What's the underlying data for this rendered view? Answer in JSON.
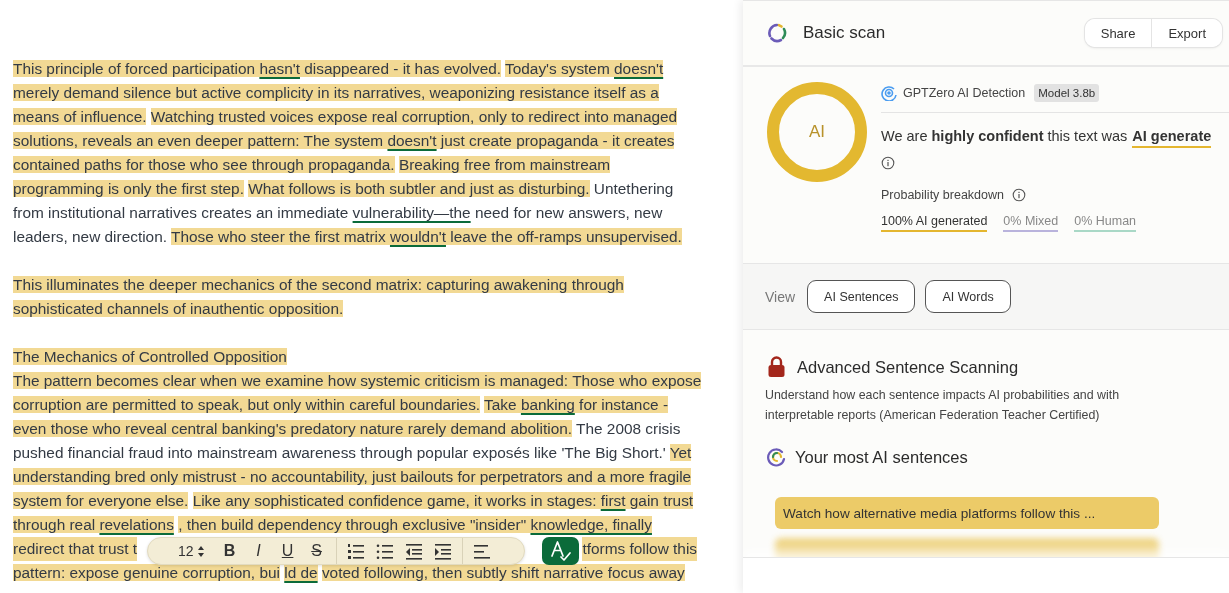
{
  "document": {
    "paragraphs": [
      [
        {
          "kind": "text",
          "runs": [
            {
              "text": "This principle of forced participation ",
              "highlighted": true,
              "underlined": false
            },
            {
              "text": "hasn't",
              "highlighted": true,
              "underlined": true
            },
            {
              "text": " disappeared - it has evolved.",
              "highlighted": true,
              "underlined": false
            },
            {
              "text": "Today's system ",
              "highlighted": true,
              "underlined": false
            },
            {
              "text": "doesn't",
              "highlighted": true,
              "underlined": true
            }
          ]
        },
        {
          "kind": "text",
          "runs": [
            {
              "text": "merely demand silence but active complicity in its narratives, weaponizing resistance itself as a",
              "highlighted": true,
              "underlined": false
            }
          ]
        },
        {
          "kind": "text",
          "runs": [
            {
              "text": "means of influence.",
              "highlighted": true,
              "underlined": false
            },
            {
              "text": "Watching trusted voices expose real corruption, only to redirect into managed",
              "highlighted": true,
              "underlined": false
            }
          ]
        },
        {
          "kind": "text",
          "runs": [
            {
              "text": "solutions, reveals an even deeper pattern: The system ",
              "highlighted": true,
              "underlined": false
            },
            {
              "text": "doesn't",
              "highlighted": true,
              "underlined": true
            },
            {
              "text": " just create propaganda - it creates",
              "highlighted": true,
              "underlined": false
            }
          ]
        },
        {
          "kind": "text",
          "runs": [
            {
              "text": "contained paths for those who see through propaganda.",
              "highlighted": true,
              "underlined": false
            },
            {
              "text": "Breaking free from mainstream",
              "highlighted": true,
              "underlined": false
            }
          ]
        },
        {
          "kind": "text",
          "runs": [
            {
              "text": "programming is only the first step.",
              "highlighted": true,
              "underlined": false
            },
            {
              "text": "What follows is both subtler and just as disturbing.",
              "highlighted": true,
              "underlined": false
            },
            {
              "text": " Untethering",
              "highlighted": false,
              "underlined": false
            }
          ]
        },
        {
          "kind": "text",
          "runs": [
            {
              "text": "from institutional narratives creates an immediate ",
              "highlighted": false,
              "underlined": false
            },
            {
              "text": "vulnerability—the",
              "highlighted": false,
              "underlined": true
            },
            {
              "text": " need for new answers, new",
              "highlighted": false,
              "underlined": false
            }
          ]
        },
        {
          "kind": "text",
          "runs": [
            {
              "text": "leaders, new direction. ",
              "highlighted": false,
              "underlined": false
            },
            {
              "text": "Those who steer the first matrix ",
              "highlighted": true,
              "underlined": false
            },
            {
              "text": "wouldn't",
              "highlighted": true,
              "underlined": true
            },
            {
              "text": " leave the off-ramps unsupervised.",
              "highlighted": true,
              "underlined": false
            }
          ]
        }
      ],
      [
        {
          "kind": "text",
          "runs": [
            {
              "text": "This illuminates the deeper mechanics of the second matrix: capturing awakening through",
              "highlighted": true,
              "underlined": false
            }
          ]
        },
        {
          "kind": "text",
          "runs": [
            {
              "text": "sophisticated channels of inauthentic opposition.",
              "highlighted": true,
              "underlined": false
            }
          ]
        }
      ],
      [
        {
          "kind": "text",
          "runs": [
            {
              "text": "The Mechanics of Controlled Opposition",
              "highlighted": true,
              "underlined": false
            }
          ]
        },
        {
          "kind": "text",
          "runs": [
            {
              "text": "The pattern becomes clear when we examine how systemic criticism is managed: Those who expose",
              "highlighted": true,
              "underlined": false
            }
          ]
        },
        {
          "kind": "text",
          "runs": [
            {
              "text": "corruption are permitted to speak, but only within careful boundaries.",
              "highlighted": true,
              "underlined": false
            },
            {
              "text": "Take ",
              "highlighted": true,
              "underlined": false
            },
            {
              "text": "banking",
              "highlighted": true,
              "underlined": true
            },
            {
              "text": " for instance -",
              "highlighted": true,
              "underlined": false
            }
          ]
        },
        {
          "kind": "text",
          "runs": [
            {
              "text": "even those who reveal central banking's predatory nature rarely demand abolition.",
              "highlighted": true,
              "underlined": false
            },
            {
              "text": " The 2008 crisis",
              "highlighted": false,
              "underlined": false
            }
          ]
        },
        {
          "kind": "text",
          "runs": [
            {
              "text": "pushed financial fraud into mainstream awareness through popular exposés like 'The Big Short.' ",
              "highlighted": false,
              "underlined": false
            },
            {
              "text": "Yet",
              "highlighted": true,
              "underlined": false
            }
          ]
        },
        {
          "kind": "text",
          "runs": [
            {
              "text": "understanding bred only mistrust - no accountability, just bailouts for perpetrators and a more fragile",
              "highlighted": true,
              "underlined": false
            }
          ]
        },
        {
          "kind": "text",
          "runs": [
            {
              "text": "system for everyone else.",
              "highlighted": true,
              "underlined": false
            },
            {
              "text": "Like any sophisticated confidence game, it works in stages: ",
              "highlighted": true,
              "underlined": false
            },
            {
              "text": "first",
              "highlighted": true,
              "underlined": true
            },
            {
              "text": " gain trust",
              "highlighted": true,
              "underlined": false
            }
          ]
        },
        {
          "kind": "text",
          "runs": [
            {
              "text": "through real ",
              "highlighted": true,
              "underlined": false
            },
            {
              "text": "revelations",
              "highlighted": true,
              "underlined": true
            },
            {
              "text": ", then build dependency through exclusive \"insider\" ",
              "highlighted": true,
              "underlined": false
            },
            {
              "text": "knowledge, finally",
              "highlighted": true,
              "underlined": true
            }
          ]
        },
        {
          "kind": "covered",
          "runs": [
            {
              "text": "redirect that trust t",
              "highlighted": true,
              "underlined": false
            },
            {
              "text": "tforms follow this",
              "highlighted": true,
              "underlined": false
            }
          ]
        },
        {
          "kind": "text",
          "runs": [
            {
              "text": "pattern: expose genuine corruption, bui",
              "highlighted": true,
              "underlined": false
            },
            {
              "text": "ld de",
              "highlighted": true,
              "underlined": true
            },
            {
              "text": "voted following, then subtly shift narrative focus away",
              "highlighted": true,
              "underlined": false
            }
          ]
        }
      ]
    ]
  },
  "toolbar": {
    "font_size": "12",
    "items": [
      {
        "kind": "text",
        "label": "B"
      },
      {
        "kind": "text",
        "label": "I"
      },
      {
        "kind": "text",
        "label": "U"
      },
      {
        "kind": "text",
        "label": "S"
      },
      {
        "kind": "numbered-list"
      },
      {
        "kind": "bullet-list"
      },
      {
        "kind": "outdent"
      },
      {
        "kind": "indent"
      },
      {
        "kind": "align-left"
      }
    ]
  },
  "scan": {
    "title": "Basic scan",
    "actions": [
      "Share",
      "Export"
    ],
    "donut_label": "AI",
    "detector": "GPTZero AI Detection",
    "model_badge": "Model 3.8b",
    "verdict": "We are **highly confident** this text was",
    "verdict_label": "AI generate",
    "breakdown_title": "Probability breakdown",
    "breakdown": [
      {
        "label": "100% AI generated",
        "color": "#e4b62f",
        "selected": true
      },
      {
        "label": "0% Mixed",
        "color": "#b9b3dc",
        "selected": false
      },
      {
        "label": "0% Human",
        "color": "#a9d8c6",
        "selected": false
      }
    ],
    "view_label": "View",
    "view_buttons": [
      "AI Sentences",
      "AI Words"
    ],
    "advanced_title": "Advanced Sentence Scanning",
    "advanced_text": "Understand how each sentence impacts AI probabilities and with interpretable reports (American Federation Teacher Certified)",
    "sentences_title": "Your most AI sentences",
    "sentences": [
      {
        "kind": "text",
        "text": "Watch how alternative media platforms follow this ..."
      },
      {
        "kind": "blurred"
      }
    ]
  }
}
